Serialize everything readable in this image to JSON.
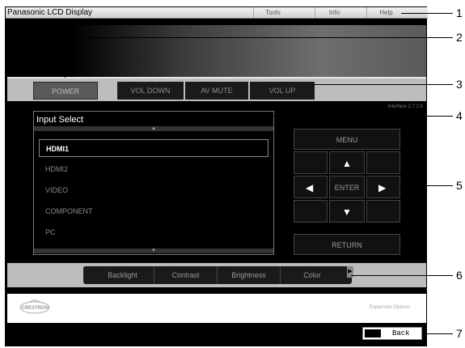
{
  "window": {
    "title": "Panasonic LCD Display"
  },
  "menu": {
    "tools": "Tools",
    "info": "Info",
    "help": "Help"
  },
  "controls": {
    "power": "POWER",
    "vol_down": "VOL DOWN",
    "av_mute": "AV MUTE",
    "vol_up": "VOL UP"
  },
  "version": "Interface 2.7.2.6",
  "input_select": {
    "title": "Input Select",
    "items": [
      "HDMI1",
      "HDMI2",
      "VIDEO",
      "COMPONENT",
      "PC"
    ],
    "selected": "HDMI1"
  },
  "nav": {
    "menu": "MENU",
    "enter": "ENTER",
    "return": "RETURN"
  },
  "adjust": {
    "items": [
      "Backlight",
      "Contrast",
      "Brightness",
      "Color"
    ]
  },
  "footer": {
    "logo_text": "CRESTRON",
    "expansion": "Expansion Options"
  },
  "back": "Back",
  "callouts": [
    "1",
    "2",
    "3",
    "4",
    "5",
    "6",
    "7"
  ]
}
